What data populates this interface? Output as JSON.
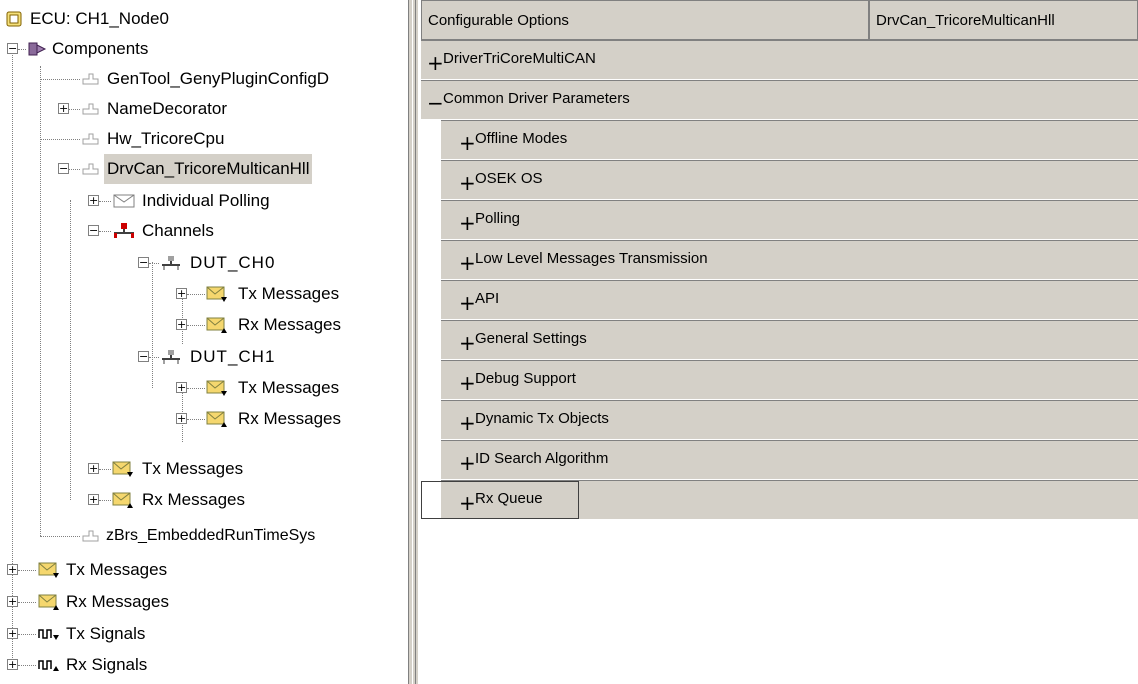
{
  "tree": {
    "root": "ECU: CH1_Node0",
    "components": "Components",
    "gentool": "GenTool_GenyPluginConfigD",
    "namedecorator": "NameDecorator",
    "hw": "Hw_TricoreCpu",
    "drvcan": "DrvCan_TricoreMulticanHll",
    "polling": "Individual Polling",
    "channels": "Channels",
    "ch0": "DUT_CH0",
    "ch0_tx": "Tx Messages",
    "ch0_rx": "Rx Messages",
    "ch1": "DUT_CH1",
    "ch1_tx": "Tx Messages",
    "ch1_rx": "Rx Messages",
    "drv_tx": "Tx Messages",
    "drv_rx": "Rx Messages",
    "zbrs": "zBrs_EmbeddedRunTimeSys",
    "tx_messages": "Tx Messages",
    "rx_messages": "Rx Messages",
    "tx_signals": "Tx Signals",
    "rx_signals": "Rx Signals"
  },
  "grid": {
    "header_left": "Configurable Options",
    "header_right": "DrvCan_TricoreMulticanHll",
    "rows": [
      {
        "sign": "+",
        "label": "DriverTriCoreMultiCAN"
      },
      {
        "sign": "−",
        "label": "Common Driver Parameters"
      },
      {
        "sign": "+",
        "label": "Offline Modes"
      },
      {
        "sign": "+",
        "label": "OSEK OS"
      },
      {
        "sign": "+",
        "label": "Polling"
      },
      {
        "sign": "+",
        "label": "Low Level Messages Transmission"
      },
      {
        "sign": "+",
        "label": "API"
      },
      {
        "sign": "+",
        "label": "General Settings"
      },
      {
        "sign": "+",
        "label": "Debug Support"
      },
      {
        "sign": "+",
        "label": "Dynamic Tx Objects"
      },
      {
        "sign": "+",
        "label": "ID Search Algorithm"
      },
      {
        "sign": "+",
        "label": "Rx Queue"
      }
    ]
  },
  "colors": {
    "panel": "#d4d0c8",
    "accent_red": "#cc0000",
    "icon_yellow": "#f5d76e"
  },
  "icons": {
    "ecu": "ecu-icon",
    "components": "components-icon",
    "plugin": "plugin-icon",
    "envelope": "envelope-icon",
    "channel": "channel-icon",
    "message": "message-icon",
    "signal": "signal-icon"
  }
}
